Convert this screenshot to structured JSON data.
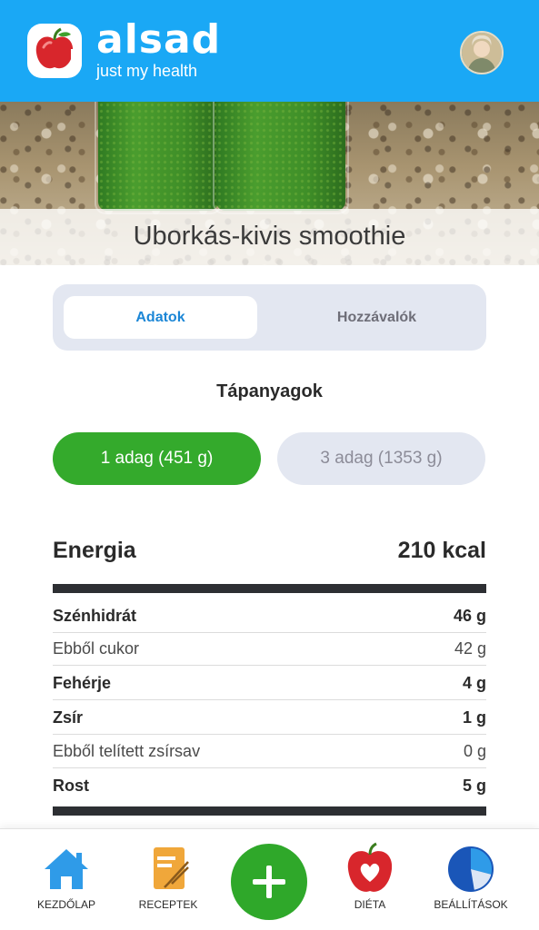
{
  "header": {
    "app_name": "alsad",
    "tagline": "just my health"
  },
  "recipe": {
    "title": "Uborkás-kivis smoothie"
  },
  "tabs": [
    {
      "label": "Adatok",
      "active": true
    },
    {
      "label": "Hozzávalók",
      "active": false
    }
  ],
  "nutrients_title": "Tápanyagok",
  "portions": [
    {
      "label": "1 adag (451 g)",
      "active": true
    },
    {
      "label": "3 adag (1353 g)",
      "active": false
    }
  ],
  "energy": {
    "label": "Energia",
    "value": "210 kcal"
  },
  "nutrients": [
    {
      "label": "Szénhidrát",
      "value": "46 g",
      "bold": true
    },
    {
      "label": "Ebből cukor",
      "value": "42 g",
      "bold": false
    },
    {
      "label": "Fehérje",
      "value": "4 g",
      "bold": true
    },
    {
      "label": "Zsír",
      "value": "1 g",
      "bold": true
    },
    {
      "label": "Ebből telített zsírsav",
      "value": "0 g",
      "bold": false
    },
    {
      "label": "Rost",
      "value": "5 g",
      "bold": true
    }
  ],
  "bottom_nav": {
    "home": "KEZDŐLAP",
    "recipes": "RECEPTEK",
    "diet": "DIÉTA",
    "settings": "BEÁLLÍTÁSOK"
  },
  "colors": {
    "header_blue": "#1aa8f5",
    "accent_green": "#34aa2c",
    "tab_blue": "#1b86d6"
  },
  "icons": {
    "logo": "apple-logo-icon",
    "home": "home-icon",
    "recipes": "recipe-book-icon",
    "add": "plus-icon",
    "diet": "heart-apple-icon",
    "settings": "pie-chart-icon"
  }
}
